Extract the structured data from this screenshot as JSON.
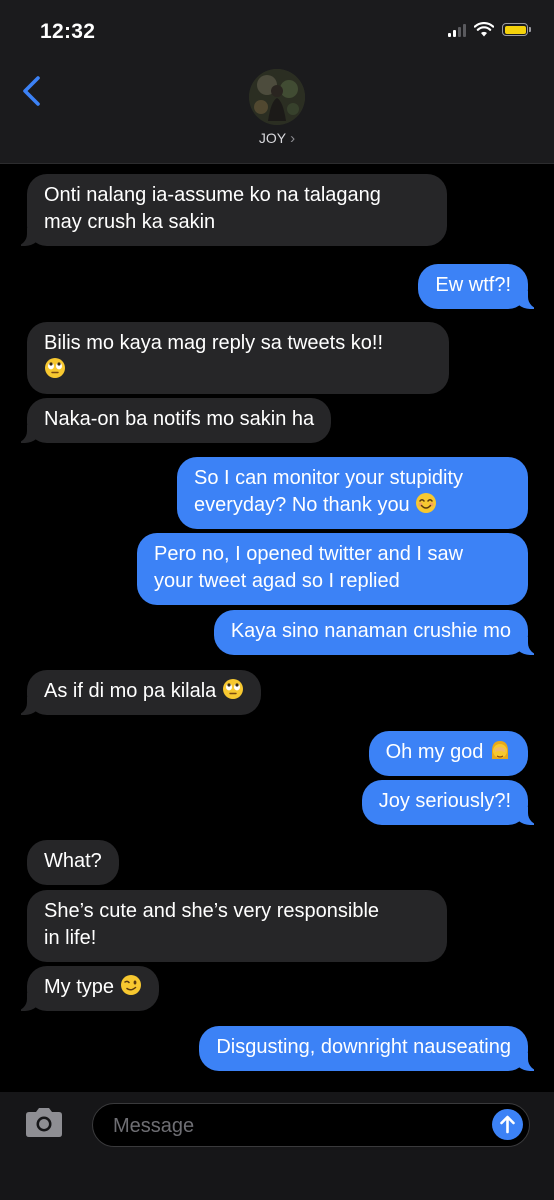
{
  "status_bar": {
    "time": "12:32"
  },
  "header": {
    "contact_name": "JOY",
    "chevron": "›",
    "back_icon": "chevron-left-icon"
  },
  "colors": {
    "incoming_bubble": "#262628",
    "outgoing_bubble": "#3c82f6",
    "accent": "#3c82f6",
    "battery": "#f5d20b"
  },
  "messages": [
    {
      "from": "them",
      "lines": [
        "Onti nalang ia-assume ko na talagang",
        "may crush ka sakin"
      ]
    },
    {
      "from": "me",
      "lines": [
        "Ew wtf?!"
      ]
    },
    {
      "from": "them",
      "lines": [
        "Bilis mo kaya mag reply sa tweets ko!!"
      ],
      "emoji": "face-with-rolling-eyes"
    },
    {
      "from": "them",
      "lines": [
        "Naka-on ba notifs mo sakin ha"
      ]
    },
    {
      "from": "me",
      "lines": [
        "So I can monitor your stupidity",
        "everyday? No thank you"
      ],
      "emoji": "smiling-face-with-smiling-eyes"
    },
    {
      "from": "me",
      "lines": [
        "Pero no, I opened twitter and I saw",
        "your tweet agad so I replied"
      ]
    },
    {
      "from": "me",
      "lines": [
        "Kaya sino nanaman crushie mo"
      ]
    },
    {
      "from": "them",
      "lines": [
        "As if di mo pa kilala"
      ],
      "emoji": "face-with-rolling-eyes"
    },
    {
      "from": "me",
      "lines": [
        "Oh my god"
      ],
      "emoji": "woman-facepalming"
    },
    {
      "from": "me",
      "lines": [
        "Joy seriously?!"
      ]
    },
    {
      "from": "them",
      "lines": [
        "What?"
      ]
    },
    {
      "from": "them",
      "lines": [
        "She’s cute and she’s very responsible",
        "in life!"
      ]
    },
    {
      "from": "them",
      "lines": [
        "My type"
      ],
      "emoji": "winking-face"
    },
    {
      "from": "me",
      "lines": [
        "Disgusting, downright nauseating"
      ]
    }
  ],
  "composer": {
    "placeholder": "Message",
    "camera_icon": "camera-icon",
    "send_icon": "arrow-up-icon"
  }
}
